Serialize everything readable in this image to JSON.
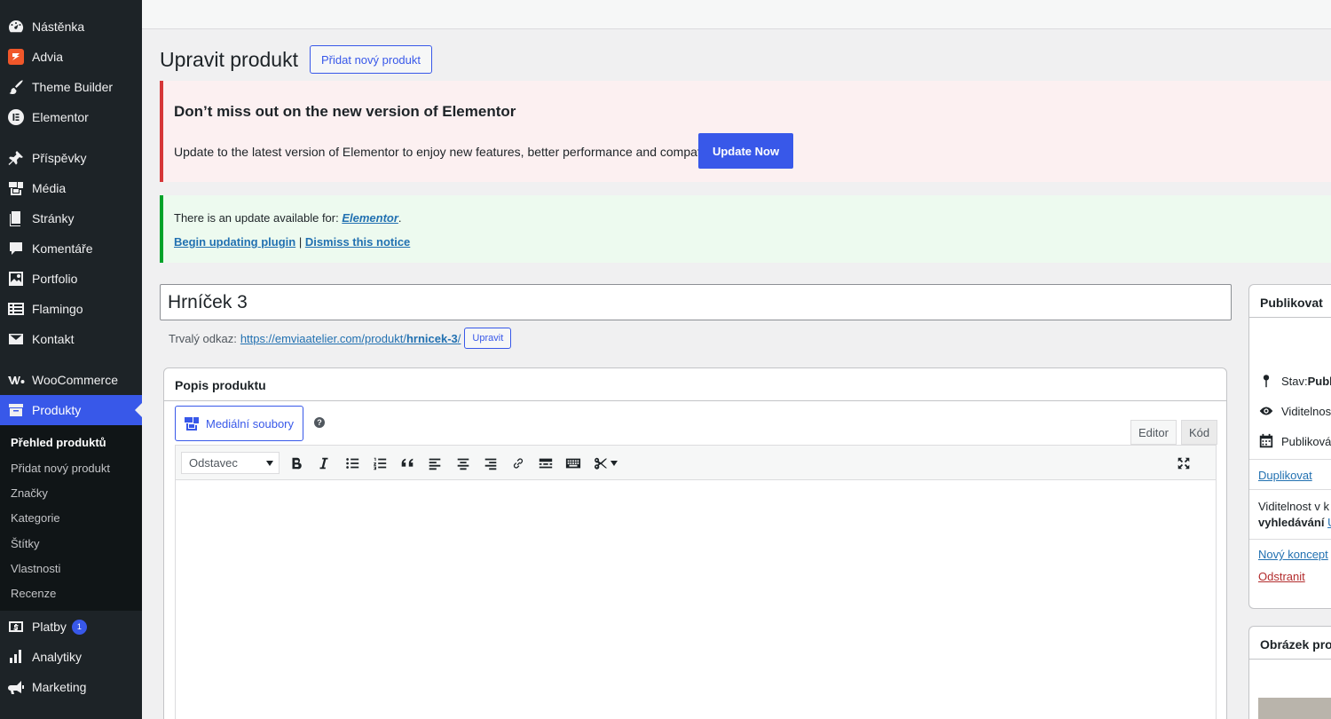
{
  "sidebar": {
    "items": [
      {
        "label": "Nástěnka",
        "icon": "dashboard-icon"
      },
      {
        "label": "Advia",
        "icon": "advia-icon"
      },
      {
        "label": "Theme Builder",
        "icon": "brush-icon"
      },
      {
        "label": "Elementor",
        "icon": "elementor-icon"
      },
      {
        "label": "Příspěvky",
        "icon": "pin-icon"
      },
      {
        "label": "Média",
        "icon": "media-icon"
      },
      {
        "label": "Stránky",
        "icon": "pages-icon"
      },
      {
        "label": "Komentáře",
        "icon": "comments-icon"
      },
      {
        "label": "Portfolio",
        "icon": "portfolio-icon"
      },
      {
        "label": "Flamingo",
        "icon": "flamingo-icon"
      },
      {
        "label": "Kontakt",
        "icon": "mail-icon"
      },
      {
        "label": "WooCommerce",
        "icon": "woocommerce-icon"
      },
      {
        "label": "Produkty",
        "icon": "archive-icon"
      }
    ],
    "submenu": [
      "Přehled produktů",
      "Přidat nový produkt",
      "Značky",
      "Kategorie",
      "Štítky",
      "Vlastnosti",
      "Recenze"
    ],
    "bottom_items": [
      {
        "label": "Platby",
        "icon": "payments-icon",
        "badge": "1"
      },
      {
        "label": "Analytiky",
        "icon": "analytics-icon"
      },
      {
        "label": "Marketing",
        "icon": "megaphone-icon"
      }
    ]
  },
  "header": {
    "title": "Upravit produkt",
    "add_new_label": "Přidat nový produkt"
  },
  "notice_elementor": {
    "title": "Don’t miss out on the new version of Elementor",
    "text": "Update to the latest version of Elementor to enjoy new features, better performance and compatibility.",
    "button": "Update Now"
  },
  "notice_update": {
    "text": "There is an update available for: ",
    "plugin": "Elementor",
    "period": ".",
    "begin_link": "Begin updating plugin",
    "separator": " | ",
    "dismiss_link": "Dismiss this notice"
  },
  "product": {
    "title_value": "Hrníček 3",
    "permalink_label": "Trvalý odkaz:",
    "permalink_base": "https://emviaatelier.com/produkt/",
    "permalink_slug": "hrnicek-3",
    "permalink_end": "/",
    "permalink_edit": "Upravit"
  },
  "description": {
    "heading": "Popis produktu",
    "media_button": "Mediální soubory",
    "help": "?",
    "tab_editor": "Editor",
    "tab_code": "Kód",
    "format_value": "Odstavec"
  },
  "publish": {
    "heading": "Publikovat",
    "status_label": "Stav: ",
    "status_value": "Publi",
    "visibility": "Viditelnost",
    "published": "Publiková",
    "duplicate": "Duplikovat",
    "catalog_visibility_1": "Viditelnost v k",
    "catalog_visibility_2": "vyhledávání",
    "catalog_visibility_link": "U",
    "new_draft": "Nový koncept",
    "delete": "Odstranit"
  },
  "image_box": {
    "heading": "Obrázek prod"
  }
}
